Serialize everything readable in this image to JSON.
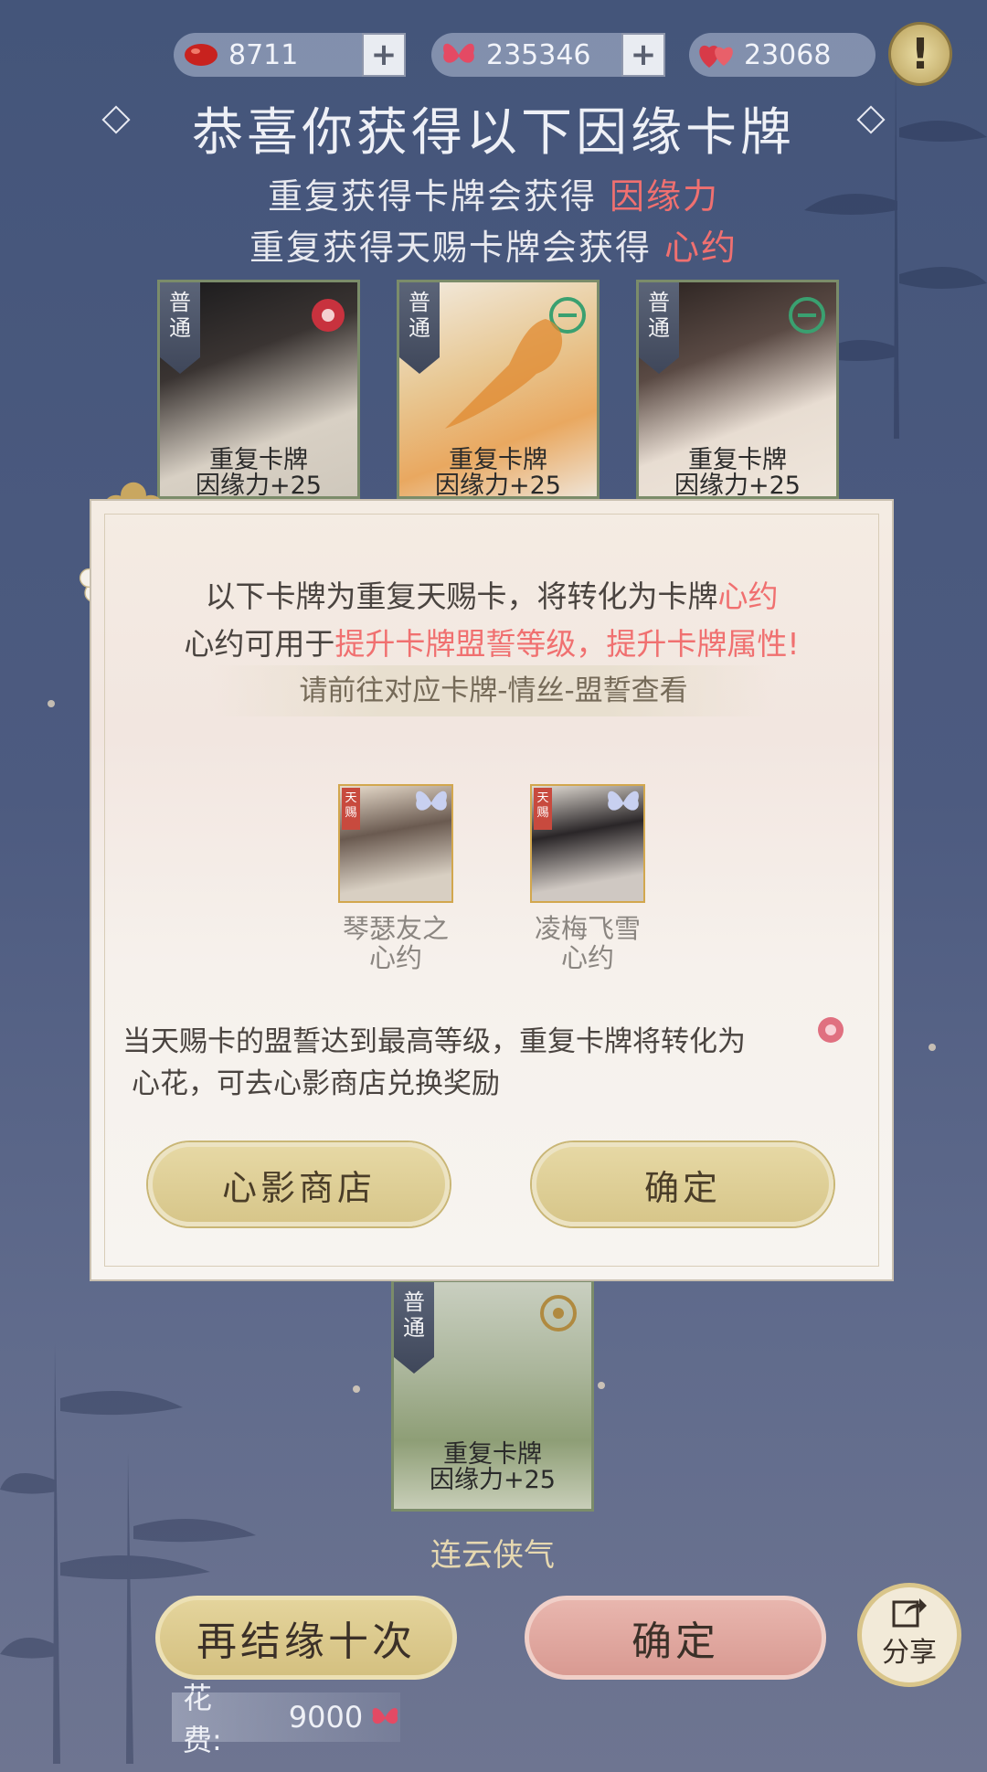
{
  "currencies": [
    {
      "icon": "red-bean-icon",
      "value": "8711",
      "plus": "+"
    },
    {
      "icon": "butterfly-icon",
      "value": "235346",
      "plus": "+"
    },
    {
      "icon": "hearts-icon",
      "value": "23068"
    }
  ],
  "alert_label": "!",
  "header": {
    "title": "恭喜你获得以下因缘卡牌",
    "line1_prefix": "重复获得卡牌会获得",
    "line1_highlight": "因缘力",
    "line2_prefix": "重复获得天赐卡牌会获得",
    "line2_highlight": "心约"
  },
  "cards": [
    {
      "badge": [
        "普",
        "通"
      ],
      "line1": "重复卡牌",
      "line2": "因缘力+25"
    },
    {
      "badge": [
        "普",
        "通"
      ],
      "line1": "重复卡牌",
      "line2": "因缘力+25"
    },
    {
      "badge": [
        "普",
        "通"
      ],
      "line1": "重复卡牌",
      "line2": "因缘力+25"
    },
    {
      "badge": [
        "普",
        "通"
      ],
      "line1": "重复卡牌",
      "line2": "因缘力+25",
      "name": "连云侠气"
    }
  ],
  "modal": {
    "line1_prefix": "以下卡牌为重复天赐卡，将转化为卡牌",
    "line1_highlight": "心约",
    "line2_prefix": "心约可用于",
    "line2_highlight": "提升卡牌盟誓等级，提升卡牌属性!",
    "band": "请前往对应卡牌-情丝-盟誓查看",
    "items": [
      {
        "tag": "天赐",
        "label1": "琴瑟友之",
        "label2": "心约"
      },
      {
        "tag": "天赐",
        "label1": "凌梅飞雪",
        "label2": "心约"
      }
    ],
    "note_line1": "当天赐卡的盟誓达到最高等级，重复卡牌将转化为",
    "note_line2": "心花，可去心影商店兑换奖励",
    "btn_shop": "心影商店",
    "btn_ok": "确定"
  },
  "bottom": {
    "btn_again": "再结缘十次",
    "btn_confirm": "确定",
    "share": "分享",
    "cost_label": "花费:",
    "cost_value": "9000"
  },
  "colors": {
    "highlight": "#f07070",
    "gold": "#d7c68a",
    "rose": "#e0a8a0",
    "background": "#4d5b80"
  }
}
